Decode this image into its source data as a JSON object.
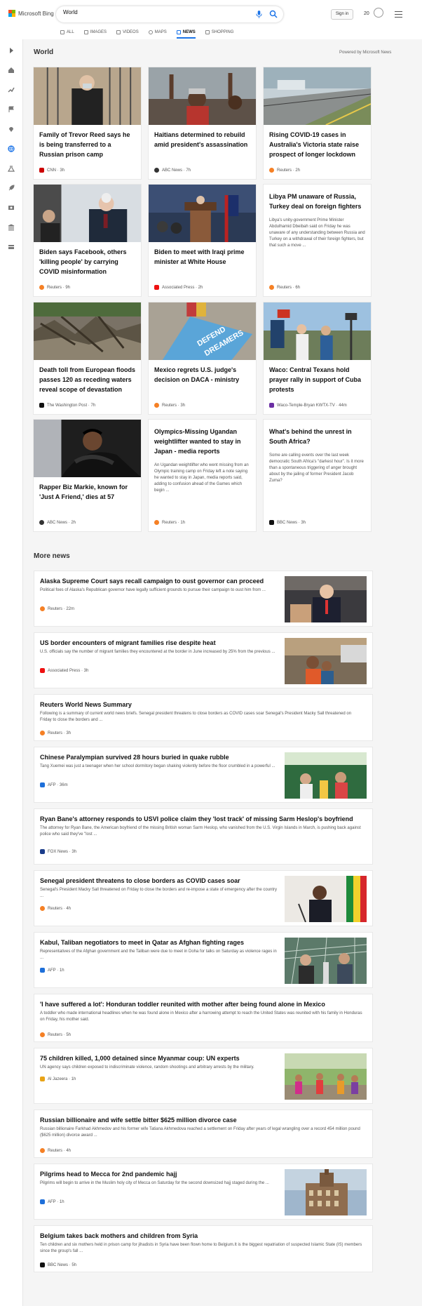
{
  "header": {
    "logo_text": "Microsoft Bing",
    "search_value": "World",
    "sign_in": "Sign in",
    "points": "20"
  },
  "scopes": [
    "ALL",
    "IMAGES",
    "VIDEOS",
    "MAPS",
    "NEWS",
    "SHOPPING"
  ],
  "active_scope": "NEWS",
  "section": {
    "title": "World",
    "powered": "Powered by Microsoft News"
  },
  "cards": [
    {
      "title": "Family of Trevor Reed says he is being transferred to a Russian prison camp",
      "source": "CNN · 3h"
    },
    {
      "title": "Haitians determined to rebuild amid president's assassination",
      "source": "ABC News · 7h"
    },
    {
      "title": "Rising COVID-19 cases in Australia's Victoria state raise prospect of longer lockdown",
      "source": "Reuters · 2h"
    },
    {
      "title": "Biden says Facebook, others 'killing people' by carrying COVID misinformation",
      "source": "Reuters · 9h"
    },
    {
      "title": "Biden to meet with Iraqi prime minister at White House",
      "source": "Associated Press · 2h"
    },
    {
      "title": "Libya PM unaware of Russia, Turkey deal on foreign fighters",
      "snippet": "Libya's unity-government Prime Minister Abdulhamid Dbeibah said on Friday he was unaware of any understanding between Russia and Turkey on a withdrawal of their foreign fighters, but that such a move ...",
      "source": "Reuters · 6h"
    },
    {
      "title": "Death toll from European floods passes 120 as receding waters reveal scope of devastation",
      "source": "The Washington Post · 7h"
    },
    {
      "title": "Mexico regrets U.S. judge's decision on DACA - ministry",
      "source": "Reuters · 3h"
    },
    {
      "title": "Waco: Central Texans hold prayer rally in support of Cuba protests",
      "source": "Waco-Temple-Bryan KWTX-TV · 44m"
    },
    {
      "title": "Rapper Biz Markie, known for 'Just A Friend,' dies at 57",
      "source": "ABC News · 2h"
    },
    {
      "title": "Olympics-Missing Ugandan weightlifter wanted to stay in Japan - media reports",
      "snippet": "An Ugandan weightlifter who went missing from an Olympic training camp on Friday left a note saying he wanted to stay in Japan, media reports said, adding to confusion ahead of the Games which begin ...",
      "source": "Reuters · 1h"
    },
    {
      "title": "What's behind the unrest in South Africa?",
      "snippet": "Some are calling events over the last week democratic South Africa's \"darkest hour\". Is it more than a spontaneous triggering of anger brought about by the jailing of former President Jacob Zuma?",
      "source": "BBC News · 3h"
    }
  ],
  "more_news_title": "More news",
  "more_news": [
    {
      "title": "Alaska Supreme Court says recall campaign to oust governor can proceed",
      "snippet": "Political foes of Alaska's Republican governor have legally sufficient grounds to pursue their campaign to oust him from ...",
      "source": "Reuters · 22m"
    },
    {
      "title": "US border encounters of migrant families rise despite heat",
      "snippet": "U.S. officials say the number of migrant families they encountered at the border in June increased by 25% from the previous ...",
      "source": "Associated Press · 3h"
    },
    {
      "title": "Reuters World News Summary",
      "snippet": "Following is a summary of current world news briefs. Senegal president threatens to close borders as COVID cases soar Senegal's President Macky Sall threatened on Friday to close the borders and ...",
      "source": "Reuters · 3h"
    },
    {
      "title": "Chinese Paralympian survived 28 hours buried in quake rubble",
      "snippet": "Tang Xuemei was just a teenager when her school dormitory began shaking violently before the floor crumbled in a powerful ...",
      "source": "AFP · 36m"
    },
    {
      "title": "Ryan Bane's attorney responds to USVI police claim they 'lost track' of missing Sarm Heslop's boyfriend",
      "snippet": "The attorney for Ryan Bane, the American boyfriend of the missing British woman Sarm Heslop, who vanished from the U.S. Virgin Islands in March, is pushing back against police who said they've \"lost ...",
      "source": "FOX News · 3h"
    },
    {
      "title": "Senegal president threatens to close borders as COVID cases soar",
      "snippet": "Senegal's President Macky Sall threatened on Friday to close the borders and re-impose a state of emergency after the country ...",
      "source": "Reuters · 4h"
    },
    {
      "title": "Kabul, Taliban negotiators to meet in Qatar as Afghan fighting rages",
      "snippet": "Representatives of the Afghan government and the Taliban were due to meet in Doha for talks on Saturday as violence rages in ...",
      "source": "AFP · 1h"
    },
    {
      "title": "'I have suffered a lot': Honduran toddler reunited with mother after being found alone in Mexico",
      "snippet": "A toddler who made international headlines when he was found alone in Mexico after a harrowing attempt to reach the United States was reunited with his family in Honduras on Friday, his mother said.",
      "source": "Reuters · 5h"
    },
    {
      "title": "75 children killed, 1,000 detained since Myanmar coup: UN experts",
      "snippet": "UN agency says children exposed to indiscriminate violence, random shootings and arbitrary arrests by the military.",
      "source": "Al Jazeera · 1h"
    },
    {
      "title": "Russian billionaire and wife settle bitter $625 million divorce case",
      "snippet": "Russian billionaire Farkhad Akhmedov and his former wife Tatiana Akhmedova reached a settlement on Friday after years of legal wrangling over a record 454 million pound ($625 million) divorce award ...",
      "source": "Reuters · 4h"
    },
    {
      "title": "Pilgrims head to Mecca for 2nd pandemic hajj",
      "snippet": "Pilgrims will begin to arrive in the Muslim holy city of Mecca on Saturday for the second downsized hajj staged during the ...",
      "source": "AFP · 1h"
    },
    {
      "title": "Belgium takes back mothers and children from Syria",
      "snippet": "Ten children and six mothers held in prison camp for jihadists in Syria have been flown home to Belgium.It is the biggest repatriation of suspected Islamic State (IS) members since the group's fall ...",
      "source": "BBC News · 5h"
    }
  ],
  "colors": {
    "accent": "#1a73e8",
    "reuters": "#f58025",
    "cnn": "#cc0000",
    "afp": "#1e6fd9"
  }
}
